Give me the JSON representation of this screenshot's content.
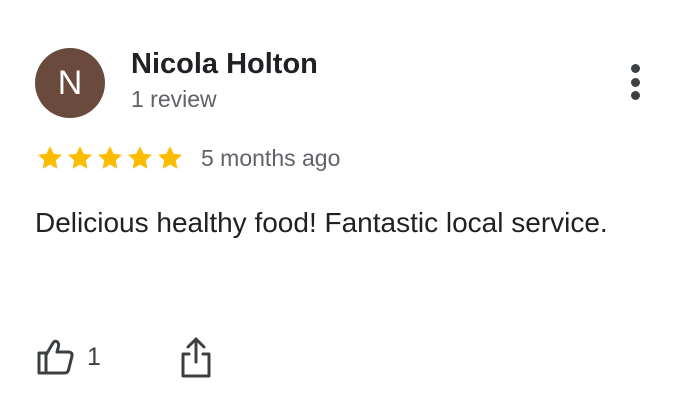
{
  "reviewer": {
    "initial": "N",
    "name": "Nicola Holton",
    "review_count_label": "1 review",
    "avatar_color": "#6b4a3e"
  },
  "menu": {
    "icon": "more-vert-icon"
  },
  "rating": {
    "stars": 5,
    "max_stars": 5,
    "star_color": "#fbbc04",
    "timestamp": "5 months ago"
  },
  "review": {
    "text": "Delicious healthy food! Fantastic local service."
  },
  "actions": {
    "like_icon": "thumbs-up-icon",
    "like_count": "1",
    "share_icon": "share-icon"
  }
}
